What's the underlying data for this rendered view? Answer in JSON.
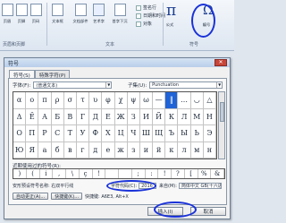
{
  "ribbon": {
    "buttons": [
      {
        "label": "页眉"
      },
      {
        "label": "页脚"
      },
      {
        "label": "页码"
      },
      {
        "label": "文本框"
      },
      {
        "label": "文档部件"
      },
      {
        "label": "艺术字"
      },
      {
        "label": "首字下沉"
      }
    ],
    "small": [
      "签名行",
      "日期和时间",
      "对象"
    ],
    "equation_label": "公式",
    "symbol_label": "编号",
    "group_header": "页眉和页脚",
    "group_text": "文本",
    "group_symbols": "符号",
    "pi": "π",
    "omega": "Ω"
  },
  "dialog": {
    "title": "符号",
    "close": "✕",
    "tabs": [
      "符号(S)",
      "特殊字符(P)"
    ],
    "font_label": "字体(F):",
    "font_value": "(普通文本)",
    "subset_label": "子集(U):",
    "subset_value": "Punctuation",
    "grid": [
      [
        "α",
        "ο",
        "π",
        "ρ",
        "σ",
        "τ",
        "υ",
        "φ",
        "χ",
        "ψ",
        "ω",
        "—",
        "‖",
        "…",
        "◡",
        "△"
      ],
      [
        "Δ",
        "Ё",
        "А",
        "Б",
        "В",
        "Г",
        "Д",
        "Е",
        "Ж",
        "З",
        "И",
        "Й",
        "К",
        "Л",
        "М",
        "Н"
      ],
      [
        "О",
        "П",
        "Р",
        "С",
        "Т",
        "У",
        "Ф",
        "Х",
        "Ц",
        "Ч",
        "Ш",
        "Щ",
        "Ъ",
        "Ы",
        "Ь",
        "Э"
      ],
      [
        "Ю",
        "Я",
        "а",
        "б",
        "в",
        "г",
        "д",
        "е",
        "ж",
        "з",
        "и",
        "й",
        "к",
        "л",
        "м",
        "н"
      ]
    ],
    "selected": [
      0,
      12
    ],
    "recent_label": "近期使用过的符号(R):",
    "recent": [
      ")",
      "(",
      "i",
      ",",
      "\\",
      "ç",
      "!",
      "",
      "",
      ";",
      ":",
      "!",
      "?",
      "[",
      "%",
      "&"
    ],
    "unicode_label": "安形预设符号名称: 右双平行线",
    "charcode_label": "字符代码(C):",
    "charcode_value": "2016",
    "from_label": "来自(M):",
    "from_value": "简体中文 GB(十六进制)",
    "autocorrect": "自动更正(A)...",
    "shortcut_btn": "快捷键(K)...",
    "shortcut_text": "快捷键: A6E3, Alt+X",
    "insert": "插入(I)",
    "cancel": "取消"
  }
}
